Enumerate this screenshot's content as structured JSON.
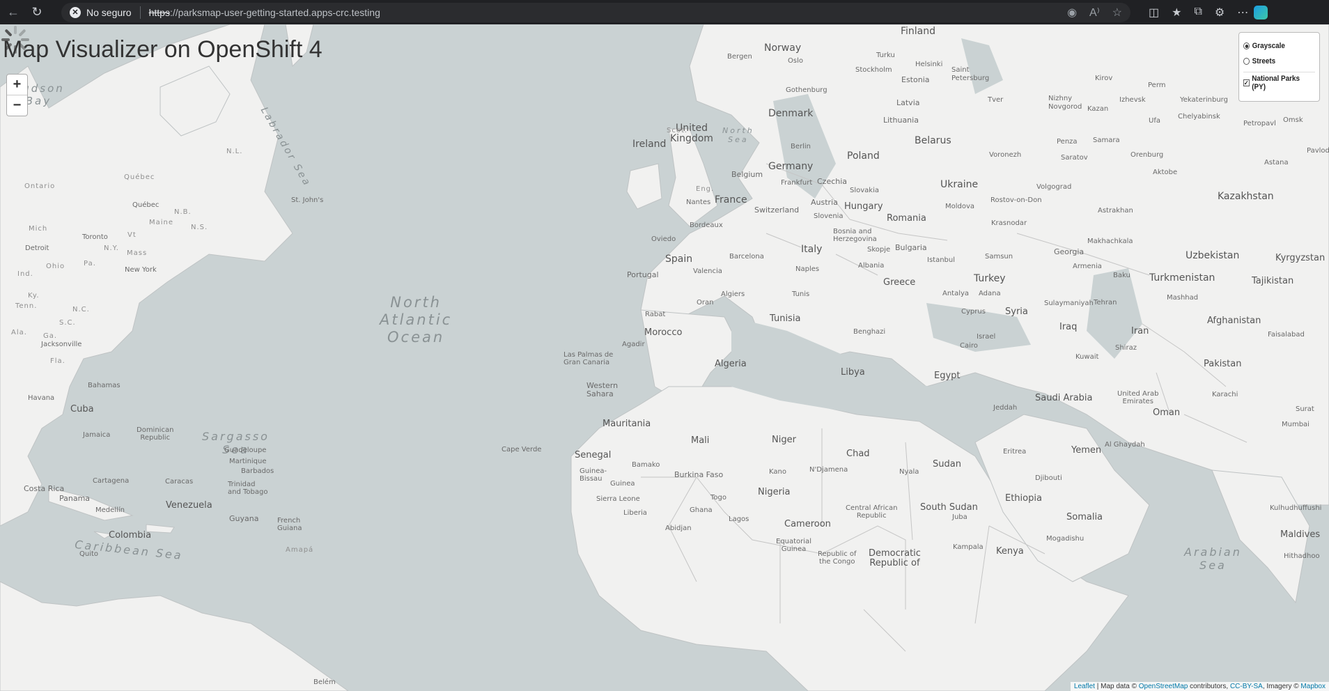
{
  "browser": {
    "security_label": "No seguro",
    "url_scheme": "https",
    "url_rest": "://parksmap-user-getting-started.apps-crc.testing"
  },
  "page": {
    "title": "Map Visualizer on OpenShift 4"
  },
  "zoom": {
    "in": "+",
    "out": "−"
  },
  "layers": {
    "base": [
      {
        "label": "Grayscale",
        "selected": true
      },
      {
        "label": "Streets",
        "selected": false
      }
    ],
    "overlay": [
      {
        "label": "National Parks (PY)",
        "checked": true
      }
    ]
  },
  "map_labels": {
    "oceans": [
      "North\nAtlantic\nOcean",
      "Sargasso\nSea",
      "Caribbean Sea",
      "Labrador Sea",
      "North\nSea",
      "Arabian\nSea",
      "Hudson\nBay"
    ],
    "countries": [
      "Finland",
      "Norway",
      "Estonia",
      "Latvia",
      "Lithuania",
      "Denmark",
      "United\nKingdom",
      "Ireland",
      "Belarus",
      "Poland",
      "Germany",
      "Czechia",
      "Slovakia",
      "Ukraine",
      "Austria",
      "Hungary",
      "Romania",
      "Moldova",
      "France",
      "Belgium",
      "Switzerland",
      "Slovenia",
      "Bosnia and\nHerzegovina",
      "Spain",
      "Portugal",
      "Italy",
      "Albania",
      "Bulgaria",
      "Greece",
      "Turkey",
      "Georgia",
      "Armenia",
      "Kazakhstan",
      "Uzbekistan",
      "Turkmenistan",
      "Kyrgyzstan",
      "Tajikistan",
      "Afghanistan",
      "Iran",
      "Iraq",
      "Syria",
      "Cyprus",
      "Israel",
      "Kuwait",
      "Pakistan",
      "Saudi Arabia",
      "United Arab\nEmirates",
      "Oman",
      "Yemen",
      "Egypt",
      "Libya",
      "Tunisia",
      "Algeria",
      "Morocco",
      "Western\nSahara",
      "Mauritania",
      "Mali",
      "Niger",
      "Chad",
      "Sudan",
      "South Sudan",
      "Ethiopia",
      "Somalia",
      "Djibouti",
      "Eritrea",
      "Nigeria",
      "Cameroon",
      "Central African\nRepublic",
      "Senegal",
      "Guinea",
      "Guinea-\nBissau",
      "Sierra Leone",
      "Liberia",
      "Ghana",
      "Togo",
      "Burkina Faso",
      "Kenya",
      "Equatorial\nGuinea",
      "Republic of\nthe Congo",
      "Democratic\nRepublic of",
      "Cuba",
      "Bahamas",
      "Dominican\nRepublic",
      "Jamaica",
      "Venezuela",
      "Colombia",
      "Guyana",
      "Costa Rica",
      "Panama",
      "Maldives"
    ],
    "cities": [
      "Bergen",
      "Oslo",
      "Turku",
      "Helsinki",
      "Saint\nPetersburg",
      "Stockholm",
      "Gothenburg",
      "Kirov",
      "Perm",
      "Izhevsk",
      "Yekaterinburg",
      "Tver",
      "Nizhny\nNovgorod",
      "Kazan",
      "Ufa",
      "Chelyabinsk",
      "Petropavl",
      "Omsk",
      "Pavlod",
      "Penza",
      "Samara",
      "Orenburg",
      "Aktobe",
      "Astana",
      "Voronezh",
      "Saratov",
      "Volgograd",
      "Rostov-on-Don",
      "Astrakhan",
      "Krasnodar",
      "Berlin",
      "Frankfurt",
      "Nantes",
      "Bordeaux",
      "Oviedo",
      "Barcelona",
      "Valencia",
      "Naples",
      "Skopje",
      "Istanbul",
      "Samsun",
      "Makhachkala",
      "Baku",
      "Tehran",
      "Mashhad",
      "Antalya",
      "Adana",
      "Sulaymaniyah",
      "Shiraz",
      "Faisalabad",
      "Karachi",
      "Mumbai",
      "Surat",
      "Algiers",
      "Tunis",
      "Oran",
      "Rabat",
      "Agadir",
      "Las Palmas de\nGran Canaria",
      "Benghazi",
      "Cairo",
      "Jeddah",
      "Al Ghaydah",
      "Kano",
      "N'Djamena",
      "Nyala",
      "Juba",
      "Bamako",
      "Abidjan",
      "Lagos",
      "Kampala",
      "Mogadishu",
      "Kulhudhuffushi",
      "Hithadhoo",
      "Cape Verde",
      "Québec",
      "Toronto",
      "Detroit",
      "New York",
      "St. John's",
      "Jacksonville",
      "Havana",
      "Guadeloupe",
      "Martinique",
      "Barbados",
      "Trinidad\nand Tobago",
      "Cartagena",
      "Caracas",
      "Medellín",
      "Quito",
      "Belém",
      "French\nGuiana",
      "Ontario",
      "Québec",
      "Maine",
      "N.B.",
      "N.S.",
      "N.L.",
      "Mich",
      "Ohio",
      "Ind.",
      "Pa.",
      "N.Y.",
      "Mass",
      "Vt",
      "Ky.",
      "Tenn.",
      "N.C.",
      "S.C.",
      "Ga.",
      "Ala.",
      "Fla.",
      "Scot.",
      "Eng.",
      "Amapá"
    ]
  },
  "attribution": {
    "leaflet": "Leaflet",
    "text1": " | Map data © ",
    "osm": "OpenStreetMap",
    "text2": " contributors, ",
    "ccbysa": "CC-BY-SA",
    "text3": ", Imagery © ",
    "mapbox": "Mapbox"
  }
}
